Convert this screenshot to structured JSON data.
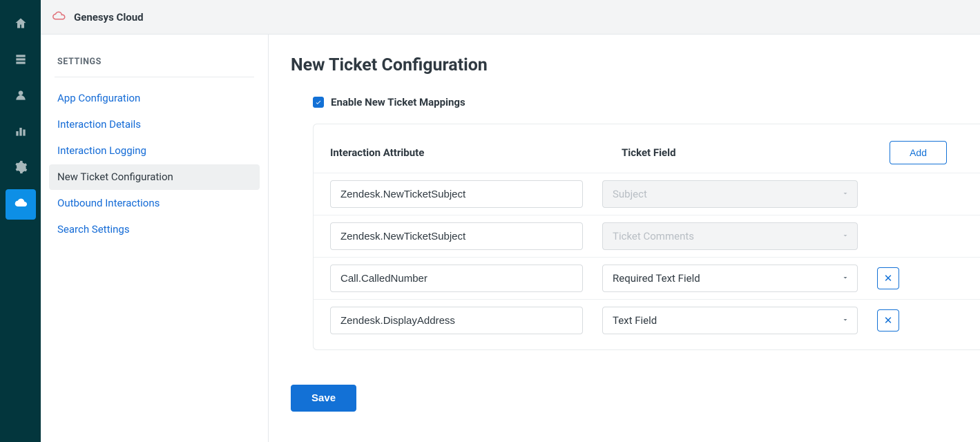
{
  "brand": {
    "title": "Genesys Cloud"
  },
  "sidebar": {
    "heading": "SETTINGS",
    "items": [
      {
        "label": "App Configuration",
        "active": false
      },
      {
        "label": "Interaction Details",
        "active": false
      },
      {
        "label": "Interaction Logging",
        "active": false
      },
      {
        "label": "New Ticket Configuration",
        "active": true
      },
      {
        "label": "Outbound Interactions",
        "active": false
      },
      {
        "label": "Search Settings",
        "active": false
      }
    ]
  },
  "page": {
    "title": "New Ticket Configuration",
    "enable_label": "Enable New Ticket Mappings",
    "enable_checked": true,
    "columns": {
      "attr": "Interaction Attribute",
      "field": "Ticket Field"
    },
    "add_label": "Add",
    "save_label": "Save",
    "rows": [
      {
        "attr": "Zendesk.NewTicketSubject",
        "field": "Subject",
        "disabled": true,
        "removable": false
      },
      {
        "attr": "Zendesk.NewTicketSubject",
        "field": "Ticket Comments",
        "disabled": true,
        "removable": false
      },
      {
        "attr": "Call.CalledNumber",
        "field": "Required Text Field",
        "disabled": false,
        "removable": true
      },
      {
        "attr": "Zendesk.DisplayAddress",
        "field": "Text Field",
        "disabled": false,
        "removable": true
      }
    ]
  }
}
